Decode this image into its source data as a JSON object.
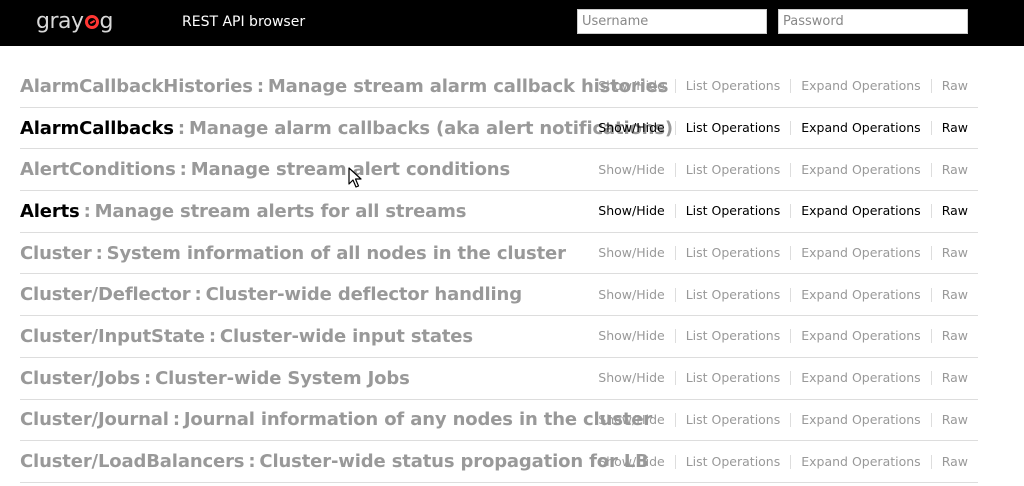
{
  "header": {
    "logo_left": "gray",
    "logo_right": "g",
    "title": "REST API browser",
    "username_placeholder": "Username",
    "password_placeholder": "Password"
  },
  "ops": {
    "show_hide": "Show/Hide",
    "list": "List Operations",
    "expand": "Expand Operations",
    "raw": "Raw"
  },
  "resources": [
    {
      "name": "AlarmCallbackHistories",
      "desc": "Manage stream alarm callback histories",
      "active": false
    },
    {
      "name": "AlarmCallbacks",
      "desc": "Manage alarm callbacks (aka alert notifications)",
      "active": true
    },
    {
      "name": "AlertConditions",
      "desc": "Manage stream alert conditions",
      "active": false
    },
    {
      "name": "Alerts",
      "desc": "Manage stream alerts for all streams",
      "active": true
    },
    {
      "name": "Cluster",
      "desc": "System information of all nodes in the cluster",
      "active": false
    },
    {
      "name": "Cluster/Deflector",
      "desc": "Cluster-wide deflector handling",
      "active": false
    },
    {
      "name": "Cluster/InputState",
      "desc": "Cluster-wide input states",
      "active": false
    },
    {
      "name": "Cluster/Jobs",
      "desc": "Cluster-wide System Jobs",
      "active": false
    },
    {
      "name": "Cluster/Journal",
      "desc": "Journal information of any nodes in the cluster",
      "active": false
    },
    {
      "name": "Cluster/LoadBalancers",
      "desc": "Cluster-wide status propagation for LB",
      "active": false
    }
  ],
  "separator": ":"
}
